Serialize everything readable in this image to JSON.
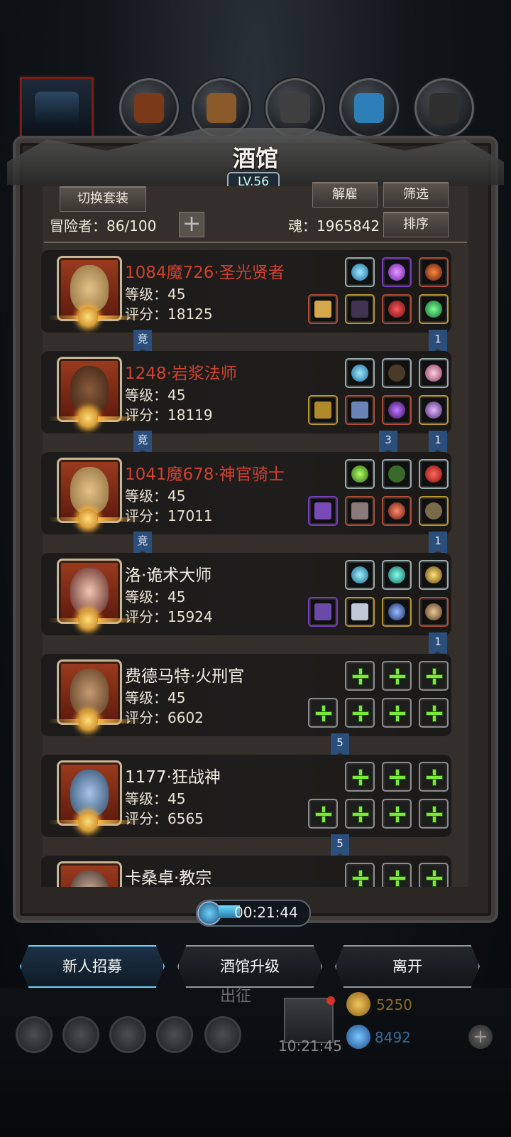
{
  "title": "酒馆",
  "level": "LV.56",
  "buttons": {
    "switch_set": "切换套装",
    "dismiss": "解雇",
    "filter": "筛选",
    "sort": "排序",
    "recruit": "新人招募",
    "upgrade": "酒馆升级",
    "leave": "离开"
  },
  "adventurers": {
    "label": "冒险者：86/100"
  },
  "soul": {
    "label": "魂：1965842"
  },
  "timer": "00:21:44",
  "bg_texts": {
    "expedition": "出征",
    "gift_time": "10:21:45",
    "gold": "5250",
    "gem": "8492"
  },
  "heroes": [
    {
      "name": "1084魔726·圣光贤者",
      "name_color": "#d0412e",
      "level": "等级：45",
      "score": "评分：18125",
      "tag_left": "竞",
      "tag_right": "1",
      "tag_mid": ""
    },
    {
      "name": "1248·岩浆法师",
      "name_color": "#d0412e",
      "level": "等级：45",
      "score": "评分：18119",
      "tag_left": "竞",
      "tag_right": "1",
      "tag_mid": "3"
    },
    {
      "name": "1041魔678·神官骑士",
      "name_color": "#d0412e",
      "level": "等级：45",
      "score": "评分：17011",
      "tag_left": "竞",
      "tag_right": "1",
      "tag_mid": ""
    },
    {
      "name": "洛·诡术大师",
      "name_color": "#f2ede2",
      "level": "等级：45",
      "score": "评分：15924",
      "tag_left": "",
      "tag_right": "1",
      "tag_mid": ""
    },
    {
      "name": "费德马特·火刑官",
      "name_color": "#f2ede2",
      "level": "等级：45",
      "score": "评分：6602",
      "tag_left": "",
      "tag_right": "",
      "tag_mid": "5"
    },
    {
      "name": "1177·狂战神",
      "name_color": "#f2ede2",
      "level": "等级：45",
      "score": "评分：6565",
      "tag_left": "",
      "tag_right": "",
      "tag_mid": "5"
    },
    {
      "name": "卡桑卓·教宗",
      "name_color": "#f2ede2",
      "level": "",
      "score": "",
      "tag_left": "",
      "tag_right": "",
      "tag_mid": ""
    }
  ]
}
